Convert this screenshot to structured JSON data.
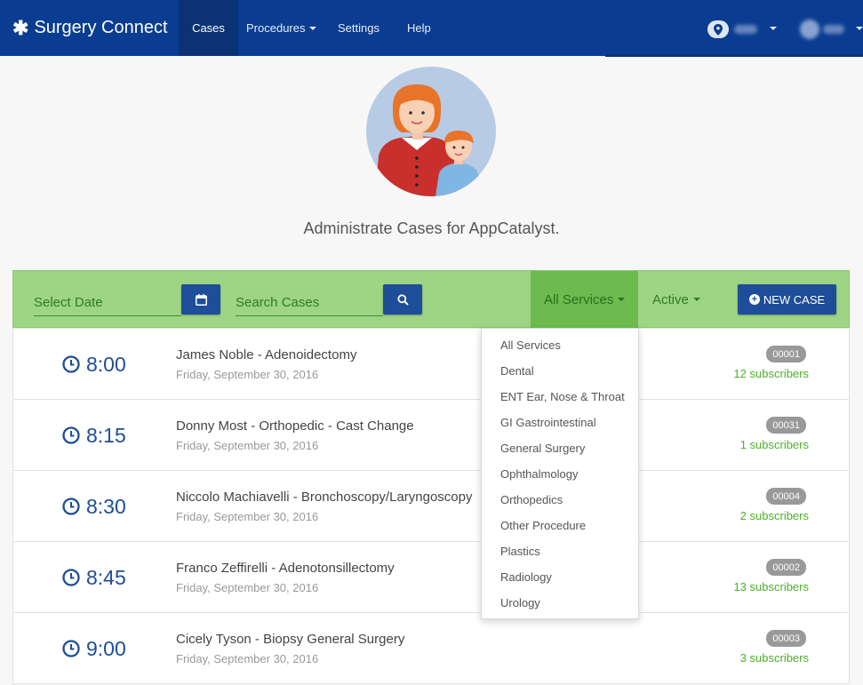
{
  "nav": {
    "brand": "Surgery Connect",
    "items": [
      {
        "label": "Cases",
        "active": true
      },
      {
        "label": "Procedures",
        "dropdown": true
      },
      {
        "label": "Settings"
      },
      {
        "label": "Help"
      }
    ],
    "accent": "#0a3d91"
  },
  "hero": {
    "title": "Administrate Cases for AppCatalyst."
  },
  "toolbar": {
    "date_placeholder": "Select Date",
    "search_placeholder": "Search Cases",
    "services_label": "All Services",
    "status_label": "Active",
    "new_case_label": "NEW CASE",
    "bg_color": "#9ed585"
  },
  "services_menu": [
    "All Services",
    "Dental",
    "ENT Ear, Nose & Throat",
    "GI Gastrointestinal",
    "General Surgery",
    "Ophthalmology",
    "Orthopedics",
    "Other Procedure",
    "Plastics",
    "Radiology",
    "Urology"
  ],
  "cases": [
    {
      "time": "8:00",
      "title": "James Noble - Adenoidectomy",
      "date": "Friday, September 30, 2016",
      "id": "00001",
      "subscribers": "12 subscribers"
    },
    {
      "time": "8:15",
      "title": "Donny Most - Orthopedic - Cast Change",
      "date": "Friday, September 30, 2016",
      "id": "00031",
      "subscribers": "1 subscribers"
    },
    {
      "time": "8:30",
      "title": "Niccolo Machiavelli - Bronchoscopy/Laryngoscopy",
      "date": "Friday, September 30, 2016",
      "id": "00004",
      "subscribers": "2 subscribers"
    },
    {
      "time": "8:45",
      "title": "Franco Zeffirelli - Adenotonsillectomy",
      "date": "Friday, September 30, 2016",
      "id": "00002",
      "subscribers": "13 subscribers"
    },
    {
      "time": "9:00",
      "title": "Cicely Tyson - Biopsy General Surgery",
      "date": "Friday, September 30, 2016",
      "id": "00003",
      "subscribers": "3 subscribers"
    }
  ]
}
